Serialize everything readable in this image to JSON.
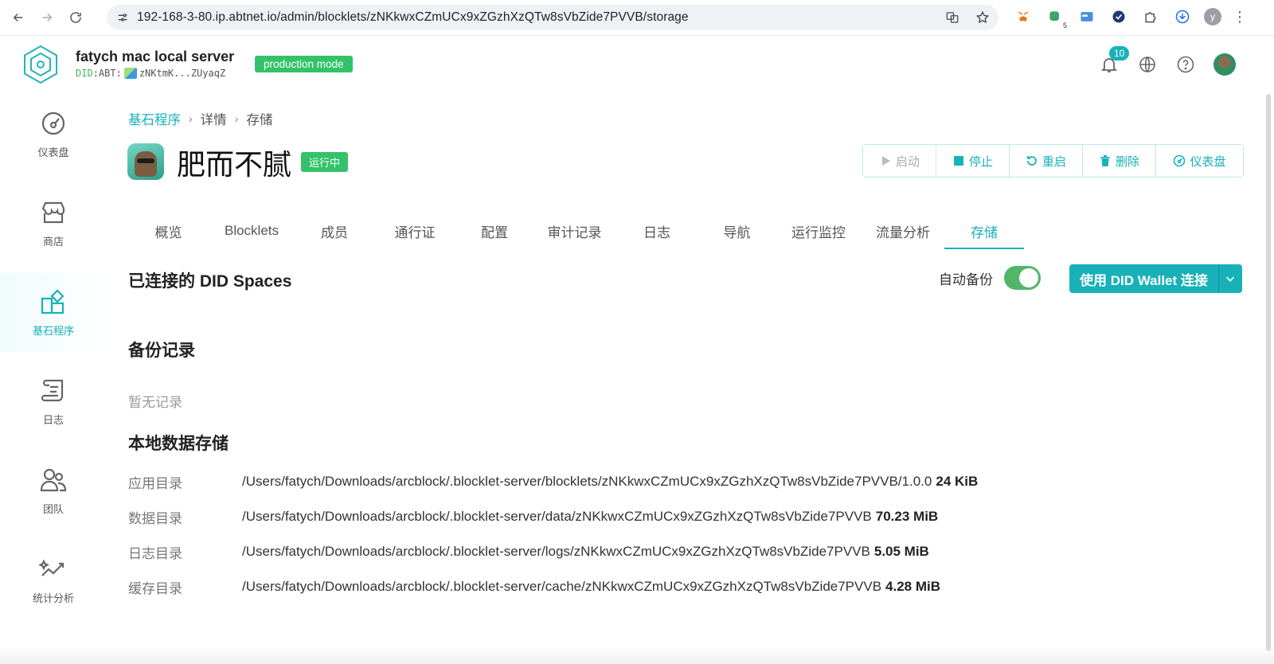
{
  "browser": {
    "url": "192-168-3-80.ip.abtnet.io/admin/blocklets/zNKkwxCZmUCx9xZGzhXzQTw8sVbZide7PVVB/storage",
    "extension_badge": "5",
    "profile_initial": "y"
  },
  "header": {
    "server_name": "fatych mac local server",
    "did_prefix": "DID",
    "did_middle": ":ABT:",
    "did_short": "zNKtmK...ZUyaqZ",
    "mode_badge": "production mode",
    "notification_count": "10"
  },
  "sidebar": {
    "items": [
      {
        "label": "仪表盘",
        "icon": "dashboard-icon"
      },
      {
        "label": "商店",
        "icon": "store-icon"
      },
      {
        "label": "基石程序",
        "icon": "blocklets-icon",
        "active": true
      },
      {
        "label": "日志",
        "icon": "log-scroll-icon"
      },
      {
        "label": "团队",
        "icon": "team-icon"
      },
      {
        "label": "统计分析",
        "icon": "analytics-icon"
      }
    ]
  },
  "breadcrumb": {
    "items": [
      "基石程序",
      "详情",
      "存储"
    ],
    "separator": "›"
  },
  "blocklet": {
    "title": "肥而不腻",
    "status": "运行中"
  },
  "actions": {
    "start": "启动",
    "stop": "停止",
    "restart": "重启",
    "delete": "删除",
    "dashboard": "仪表盘"
  },
  "tabs": [
    {
      "label": "概览"
    },
    {
      "label": "Blocklets"
    },
    {
      "label": "成员"
    },
    {
      "label": "通行证"
    },
    {
      "label": "配置"
    },
    {
      "label": "审计记录"
    },
    {
      "label": "日志"
    },
    {
      "label": "导航"
    },
    {
      "label": "运行监控"
    },
    {
      "label": "流量分析"
    },
    {
      "label": "存储",
      "active": true
    }
  ],
  "connected_spaces": {
    "title": "已连接的 DID Spaces",
    "auto_backup_label": "自动备份",
    "auto_backup_on": true,
    "connect_button": "使用 DID Wallet 连接"
  },
  "backup_records": {
    "title": "备份记录",
    "empty": "暂无记录"
  },
  "local_storage": {
    "title": "本地数据存储",
    "rows": [
      {
        "label": "应用目录",
        "path": "/Users/fatych/Downloads/arcblock/.blocklet-server/blocklets/zNKkwxCZmUCx9xZGzhXzQTw8sVbZide7PVVB/1.0.0",
        "size": "24 KiB"
      },
      {
        "label": "数据目录",
        "path": "/Users/fatych/Downloads/arcblock/.blocklet-server/data/zNKkwxCZmUCx9xZGzhXzQTw8sVbZide7PVVB",
        "size": "70.23 MiB"
      },
      {
        "label": "日志目录",
        "path": "/Users/fatych/Downloads/arcblock/.blocklet-server/logs/zNKkwxCZmUCx9xZGzhXzQTw8sVbZide7PVVB",
        "size": "5.05 MiB"
      },
      {
        "label": "缓存目录",
        "path": "/Users/fatych/Downloads/arcblock/.blocklet-server/cache/zNKkwxCZmUCx9xZGzhXzQTw8sVbZide7PVVB",
        "size": "4.28 MiB"
      }
    ]
  },
  "colors": {
    "accent": "#18b1b8",
    "success": "#33c26a",
    "toggle_on": "#52b56a"
  }
}
